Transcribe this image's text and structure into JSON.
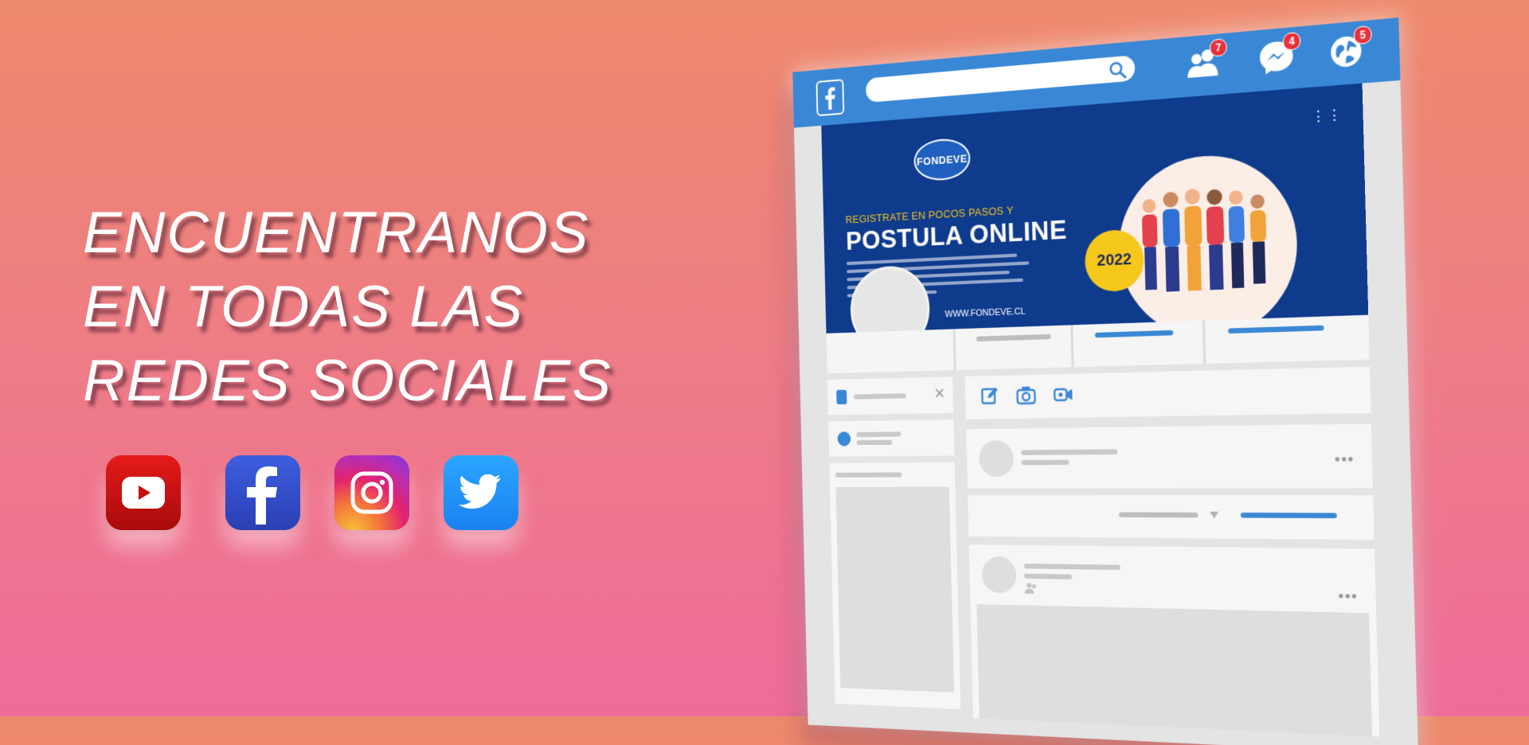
{
  "headline": {
    "line1": "ENCUENTRANOS",
    "line2": "EN TODAS LAS",
    "line3": "REDES SOCIALES"
  },
  "social_icons": [
    "youtube-icon",
    "facebook-icon",
    "instagram-icon",
    "twitter-icon"
  ],
  "mockup": {
    "badges": {
      "friends": "7",
      "messages": "4",
      "notifications": "5"
    },
    "cover": {
      "logo_text": "FONDEVE",
      "subtitle": "REGISTRATE EN POCOS PASOS Y",
      "title": "POSTULA ONLINE",
      "year": "2022",
      "url": "WWW.FONDEVE.CL"
    },
    "close_symbol": "✕",
    "more_symbol": "•••"
  },
  "colors": {
    "facebook_blue": "#3a88d5",
    "cover_navy": "#0f3b8d",
    "accent_yellow": "#f7c81c"
  }
}
